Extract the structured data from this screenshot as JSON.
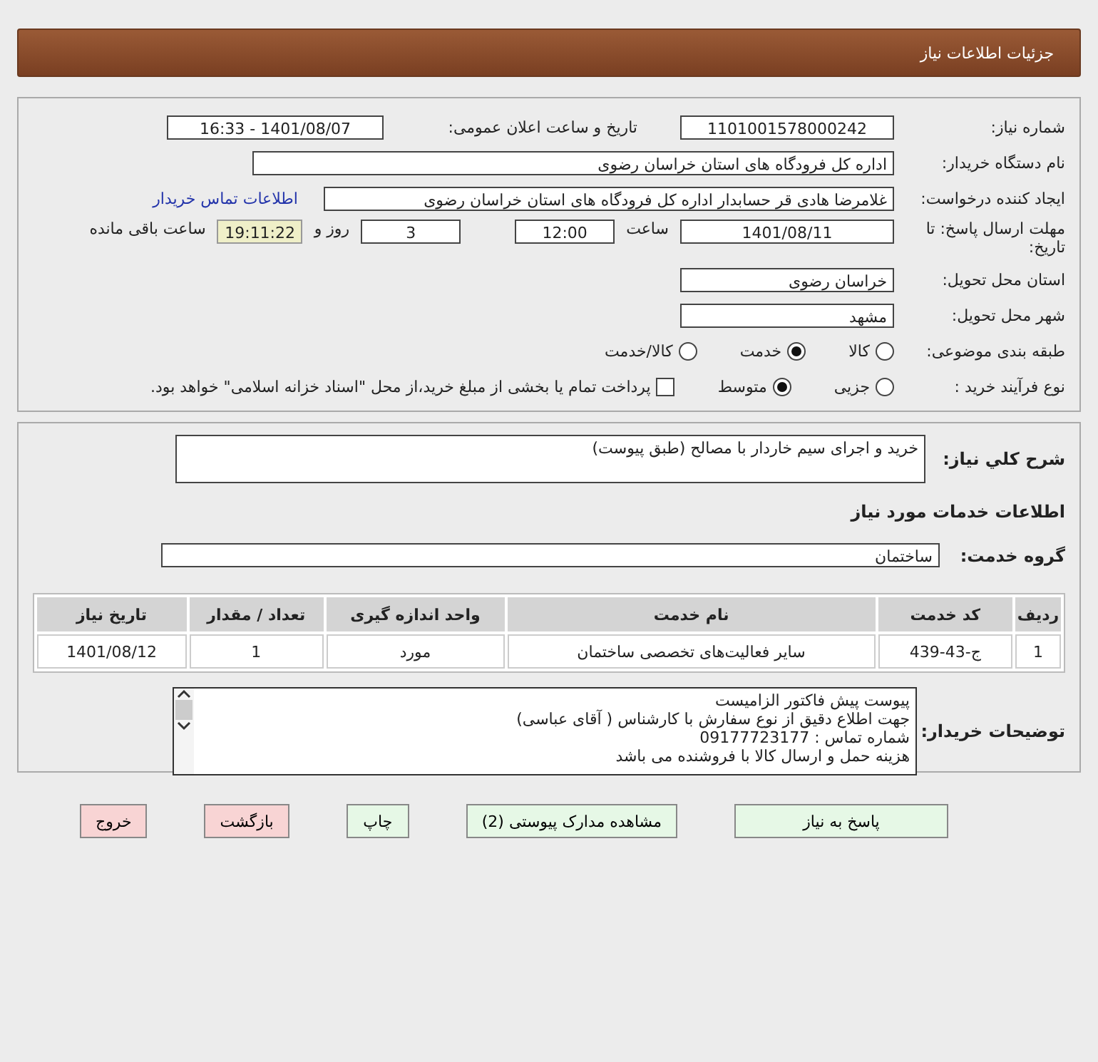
{
  "header": {
    "title": "جزئیات اطلاعات نیاز"
  },
  "need_number": {
    "label": "شماره نیاز:",
    "value": "1101001578000242"
  },
  "announce": {
    "label": "تاریخ و ساعت اعلان عمومی:",
    "value": "1401/08/07 - 16:33"
  },
  "buyer_org": {
    "label": "نام دستگاه خریدار:",
    "value": "اداره کل فرودگاه های استان خراسان رضوی"
  },
  "requester": {
    "label": "ایجاد کننده درخواست:",
    "value": "غلامرضا هادی قر حسابدار اداره کل فرودگاه های استان خراسان رضوی",
    "link": "اطلاعات تماس خریدار"
  },
  "deadline": {
    "label": "مهلت ارسال پاسخ: تا تاریخ:",
    "date": "1401/08/11",
    "time_label": "ساعت",
    "time": "12:00",
    "days": "3",
    "days_label": "روز و",
    "remaining": "19:11:22",
    "remaining_label": "ساعت باقی مانده"
  },
  "province": {
    "label": "استان محل تحویل:",
    "value": "خراسان رضوی"
  },
  "city": {
    "label": "شهر محل تحویل:",
    "value": "مشهد"
  },
  "category": {
    "label": "طبقه بندی موضوعی:",
    "options": [
      {
        "label": "کالا",
        "selected": false
      },
      {
        "label": "خدمت",
        "selected": true
      },
      {
        "label": "کالا/خدمت",
        "selected": false
      }
    ]
  },
  "process": {
    "label": "نوع فرآیند خرید :",
    "options": [
      {
        "label": "جزیی",
        "selected": false
      },
      {
        "label": "متوسط",
        "selected": true
      }
    ],
    "treasury": {
      "checked": false,
      "label": "پرداخت تمام یا بخشی از مبلغ خرید،از محل \"اسناد خزانه اسلامی\" خواهد بود."
    }
  },
  "description": {
    "label": "شرح کلي نياز:",
    "value": "خرید و اجرای سیم خاردار با مصالح (طبق پیوست)"
  },
  "section_title": "اطلاعات خدمات مورد نیاز",
  "service_group": {
    "label": "گروه خدمت:",
    "value": "ساختمان"
  },
  "table": {
    "columns": [
      "ردیف",
      "کد خدمت",
      "نام خدمت",
      "واحد اندازه گیری",
      "تعداد / مقدار",
      "تاریخ نیاز"
    ],
    "rows": [
      [
        "1",
        "ج-43-439",
        "سایر فعالیت‌های تخصصی ساختمان",
        "مورد",
        "1",
        "1401/08/12"
      ]
    ]
  },
  "buyer_notes": {
    "label": "توضیحات خریدار:",
    "lines": [
      "پیوست پیش فاکتور الزامیست",
      "جهت اطلاع دقیق از نوع سفارش با کارشناس  ( آقای عباسی)",
      "شماره تماس : 09177723177",
      "هزینه حمل و ارسال کالا با فروشنده می باشد"
    ]
  },
  "buttons": [
    {
      "label": "پاسخ به نیاز",
      "kind": "normal"
    },
    {
      "label": "مشاهده مدارک پیوستی (2)",
      "kind": "normal"
    },
    {
      "label": "چاپ",
      "kind": "normal"
    },
    {
      "label": "بازگشت",
      "kind": "danger"
    },
    {
      "label": "خروج",
      "kind": "danger"
    }
  ]
}
